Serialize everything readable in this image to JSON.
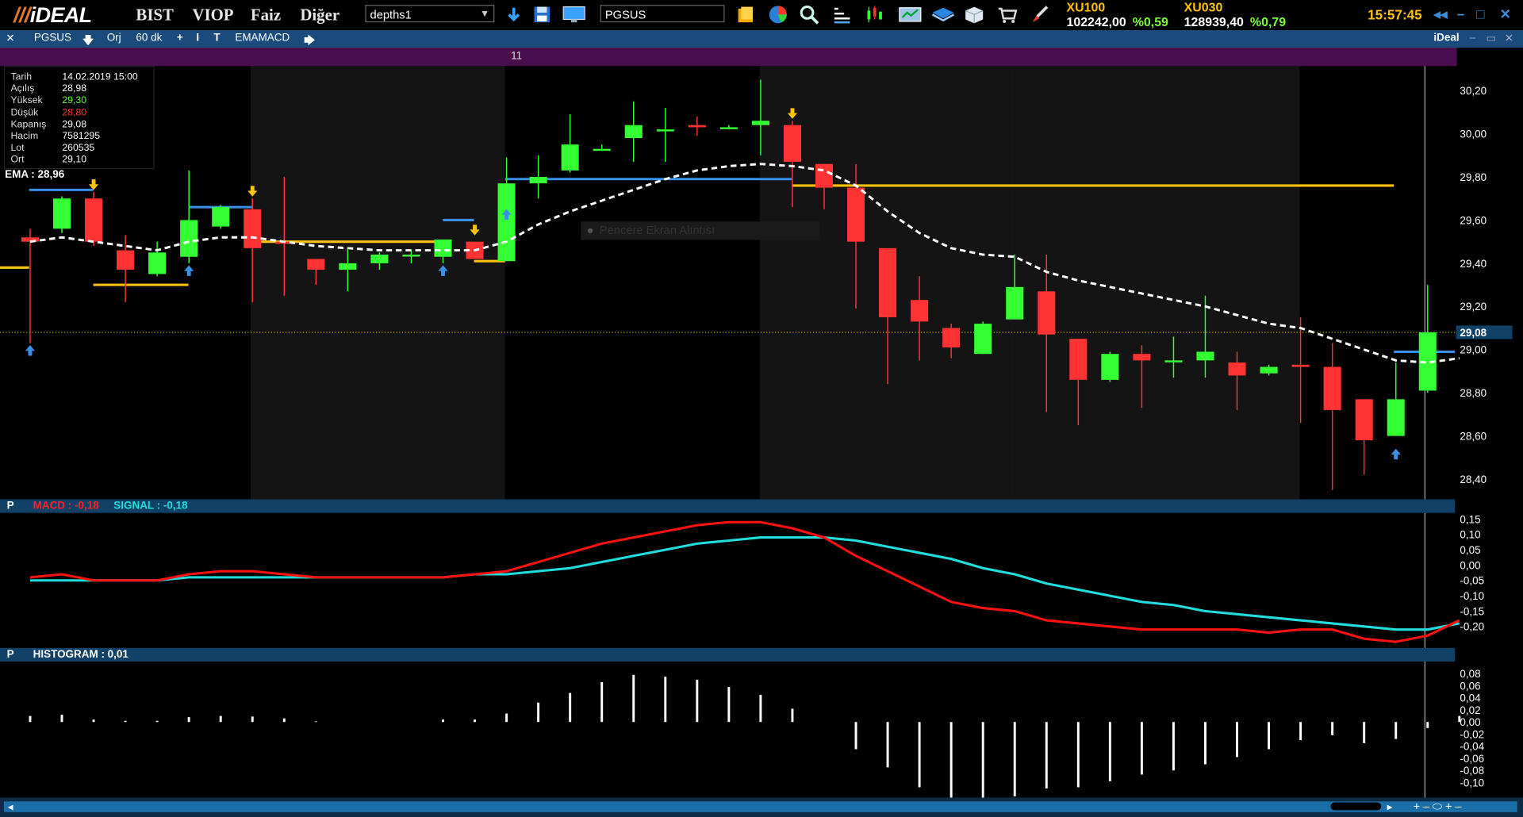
{
  "app": {
    "logo": "iDEAL",
    "menus": [
      "BIST",
      "VIOP",
      "Faiz",
      "Diğer"
    ],
    "layout_combo": "depths1",
    "symbol_input": "PGSUS",
    "indices": [
      {
        "name": "XU100",
        "value": "102242,00",
        "pct": "%0,59"
      },
      {
        "name": "XU030",
        "value": "128939,40",
        "pct": "%0,79"
      }
    ],
    "clock": "15:57:45",
    "window_controls": [
      "◂◂",
      "–",
      "□",
      "✕"
    ]
  },
  "chart_toolbar": {
    "close": "✕",
    "symbol": "PGSUS",
    "orj": "Orj",
    "period": "60 dk",
    "plus": "+",
    "indicator": "EMAMACD",
    "brand": "iDeal"
  },
  "period_bar": {
    "label": "11"
  },
  "info": {
    "rows": [
      {
        "k": "Tarih",
        "v": "14.02.2019 15:00",
        "color": "#ffffff"
      },
      {
        "k": "Açılış",
        "v": "28,98",
        "color": "#ffffff"
      },
      {
        "k": "Yüksek",
        "v": "29,30",
        "color": "#66ff33"
      },
      {
        "k": "Düşük",
        "v": "28,80",
        "color": "#ff3333"
      },
      {
        "k": "Kapanış",
        "v": "29,08",
        "color": "#ffffff"
      },
      {
        "k": "Hacim",
        "v": "7581295",
        "color": "#ffffff"
      },
      {
        "k": "Lot",
        "v": "260535",
        "color": "#ffffff"
      },
      {
        "k": "Ort",
        "v": "29,10",
        "color": "#ffffff"
      }
    ],
    "ema_label": "EMA : 28,96"
  },
  "tooltip": "Pencere Ekran Alıntısı",
  "price_axis": {
    "ticks": [
      "30,20",
      "30,00",
      "29,80",
      "29,60",
      "29,40",
      "29,20",
      "29,00",
      "28,80",
      "28,60",
      "28,40"
    ],
    "current": "29,08"
  },
  "macd_panel": {
    "p": "P",
    "macd": "MACD : -0,18",
    "signal": "SIGNAL : -0,18",
    "ticks": [
      "0,15",
      "0,10",
      "0,05",
      "0,00",
      "-0,05",
      "-0,10",
      "-0,15",
      "-0,20"
    ]
  },
  "hist_panel": {
    "p": "P",
    "label": "HISTOGRAM : 0,01",
    "ticks": [
      "0,08",
      "0,06",
      "0,04",
      "0,02",
      "0,00",
      "-0,02",
      "-0,04",
      "-0,06",
      "-0,08",
      "-0,10"
    ]
  },
  "colors": {
    "up": "#33ff33",
    "down": "#ff3333",
    "ema": "#ffffff",
    "macd": "#ff1111",
    "signal": "#22dddd",
    "accent": "#ffc20e"
  },
  "chart_data": {
    "type": "candlestick",
    "ylim": [
      28.32,
      30.3
    ],
    "candles": [
      {
        "o": 29.52,
        "h": 29.56,
        "l": 29.03,
        "c": 29.5
      },
      {
        "o": 29.56,
        "h": 29.71,
        "l": 29.54,
        "c": 29.7
      },
      {
        "o": 29.7,
        "h": 29.73,
        "l": 29.48,
        "c": 29.5
      },
      {
        "o": 29.46,
        "h": 29.53,
        "l": 29.22,
        "c": 29.37
      },
      {
        "o": 29.35,
        "h": 29.5,
        "l": 29.34,
        "c": 29.45
      },
      {
        "o": 29.43,
        "h": 29.83,
        "l": 29.4,
        "c": 29.6
      },
      {
        "o": 29.57,
        "h": 29.67,
        "l": 29.56,
        "c": 29.66
      },
      {
        "o": 29.65,
        "h": 29.7,
        "l": 29.22,
        "c": 29.47
      },
      {
        "o": 29.5,
        "h": 29.8,
        "l": 29.25,
        "c": 29.49
      },
      {
        "o": 29.42,
        "h": 29.42,
        "l": 29.3,
        "c": 29.37
      },
      {
        "o": 29.37,
        "h": 29.47,
        "l": 29.27,
        "c": 29.4
      },
      {
        "o": 29.4,
        "h": 29.45,
        "l": 29.37,
        "c": 29.44
      },
      {
        "o": 29.44,
        "h": 29.46,
        "l": 29.4,
        "c": 29.44
      },
      {
        "o": 29.43,
        "h": 29.5,
        "l": 29.4,
        "c": 29.51
      },
      {
        "o": 29.5,
        "h": 29.5,
        "l": 29.42,
        "c": 29.42
      },
      {
        "o": 29.41,
        "h": 29.89,
        "l": 29.41,
        "c": 29.77
      },
      {
        "o": 29.77,
        "h": 29.9,
        "l": 29.7,
        "c": 29.8
      },
      {
        "o": 29.83,
        "h": 30.09,
        "l": 29.82,
        "c": 29.95
      },
      {
        "o": 29.93,
        "h": 29.95,
        "l": 29.92,
        "c": 29.93
      },
      {
        "o": 29.98,
        "h": 30.15,
        "l": 29.87,
        "c": 30.04
      },
      {
        "o": 30.02,
        "h": 30.12,
        "l": 29.87,
        "c": 30.02
      },
      {
        "o": 30.04,
        "h": 30.08,
        "l": 29.99,
        "c": 30.03
      },
      {
        "o": 30.03,
        "h": 30.04,
        "l": 30.02,
        "c": 30.03
      },
      {
        "o": 30.04,
        "h": 30.25,
        "l": 29.9,
        "c": 30.06
      },
      {
        "o": 30.04,
        "h": 30.06,
        "l": 29.66,
        "c": 29.87
      },
      {
        "o": 29.86,
        "h": 29.86,
        "l": 29.65,
        "c": 29.75
      },
      {
        "o": 29.75,
        "h": 29.86,
        "l": 29.19,
        "c": 29.5
      },
      {
        "o": 29.47,
        "h": 29.47,
        "l": 28.84,
        "c": 29.15
      },
      {
        "o": 29.23,
        "h": 29.34,
        "l": 28.95,
        "c": 29.13
      },
      {
        "o": 29.1,
        "h": 29.12,
        "l": 28.96,
        "c": 29.01
      },
      {
        "o": 28.98,
        "h": 29.13,
        "l": 28.98,
        "c": 29.12
      },
      {
        "o": 29.14,
        "h": 29.44,
        "l": 29.14,
        "c": 29.29
      },
      {
        "o": 29.27,
        "h": 29.44,
        "l": 28.71,
        "c": 29.07
      },
      {
        "o": 29.05,
        "h": 29.05,
        "l": 28.65,
        "c": 28.86
      },
      {
        "o": 28.86,
        "h": 28.99,
        "l": 28.85,
        "c": 28.98
      },
      {
        "o": 28.98,
        "h": 29.02,
        "l": 28.73,
        "c": 28.95
      },
      {
        "o": 28.95,
        "h": 29.06,
        "l": 28.87,
        "c": 28.95
      },
      {
        "o": 28.95,
        "h": 29.25,
        "l": 28.87,
        "c": 28.99
      },
      {
        "o": 28.94,
        "h": 28.99,
        "l": 28.72,
        "c": 28.88
      },
      {
        "o": 28.89,
        "h": 28.93,
        "l": 28.88,
        "c": 28.92
      },
      {
        "o": 28.93,
        "h": 29.15,
        "l": 28.66,
        "c": 28.92
      },
      {
        "o": 28.92,
        "h": 29.03,
        "l": 28.35,
        "c": 28.72
      },
      {
        "o": 28.77,
        "h": 28.77,
        "l": 28.42,
        "c": 28.58
      },
      {
        "o": 28.6,
        "h": 28.94,
        "l": 28.6,
        "c": 28.77
      },
      {
        "o": 28.81,
        "h": 29.3,
        "l": 28.8,
        "c": 29.08
      }
    ],
    "ema": [
      29.5,
      29.52,
      29.5,
      29.48,
      29.46,
      29.5,
      29.52,
      29.52,
      29.5,
      29.48,
      29.47,
      29.46,
      29.46,
      29.46,
      29.46,
      29.5,
      29.58,
      29.64,
      29.69,
      29.74,
      29.79,
      29.83,
      29.85,
      29.86,
      29.85,
      29.83,
      29.76,
      29.64,
      29.54,
      29.47,
      29.44,
      29.43,
      29.36,
      29.32,
      29.29,
      29.26,
      29.23,
      29.2,
      29.16,
      29.12,
      29.1,
      29.05,
      29.0,
      28.95,
      28.94,
      28.96
    ],
    "macd": [
      -0.04,
      -0.03,
      -0.05,
      -0.05,
      -0.05,
      -0.03,
      -0.02,
      -0.02,
      -0.03,
      -0.04,
      -0.04,
      -0.04,
      -0.04,
      -0.04,
      -0.03,
      -0.02,
      0.01,
      0.04,
      0.07,
      0.09,
      0.11,
      0.13,
      0.14,
      0.14,
      0.12,
      0.09,
      0.03,
      -0.02,
      -0.07,
      -0.12,
      -0.14,
      -0.15,
      -0.18,
      -0.19,
      -0.2,
      -0.21,
      -0.21,
      -0.21,
      -0.21,
      -0.22,
      -0.21,
      -0.21,
      -0.24,
      -0.25,
      -0.23,
      -0.18
    ],
    "signal": [
      -0.05,
      -0.05,
      -0.05,
      -0.05,
      -0.05,
      -0.04,
      -0.04,
      -0.04,
      -0.04,
      -0.04,
      -0.04,
      -0.04,
      -0.04,
      -0.04,
      -0.03,
      -0.03,
      -0.02,
      -0.01,
      0.01,
      0.03,
      0.05,
      0.07,
      0.08,
      0.09,
      0.09,
      0.09,
      0.08,
      0.06,
      0.04,
      0.02,
      -0.01,
      -0.03,
      -0.06,
      -0.08,
      -0.1,
      -0.12,
      -0.13,
      -0.15,
      -0.16,
      -0.17,
      -0.18,
      -0.19,
      -0.2,
      -0.21,
      -0.21,
      -0.19
    ],
    "histogram": [
      0.01,
      0.012,
      0.004,
      0.002,
      0.002,
      0.008,
      0.01,
      0.009,
      0.006,
      0.001,
      0.0,
      0.0,
      0.0,
      0.004,
      0.004,
      0.014,
      0.032,
      0.048,
      0.066,
      0.078,
      0.075,
      0.07,
      0.058,
      0.045,
      0.022,
      0.0,
      -0.045,
      -0.075,
      -0.108,
      -0.128,
      -0.13,
      -0.123,
      -0.11,
      -0.108,
      -0.098,
      -0.087,
      -0.08,
      -0.07,
      -0.058,
      -0.045,
      -0.03,
      -0.022,
      -0.035,
      -0.028,
      -0.01,
      0.01
    ]
  }
}
